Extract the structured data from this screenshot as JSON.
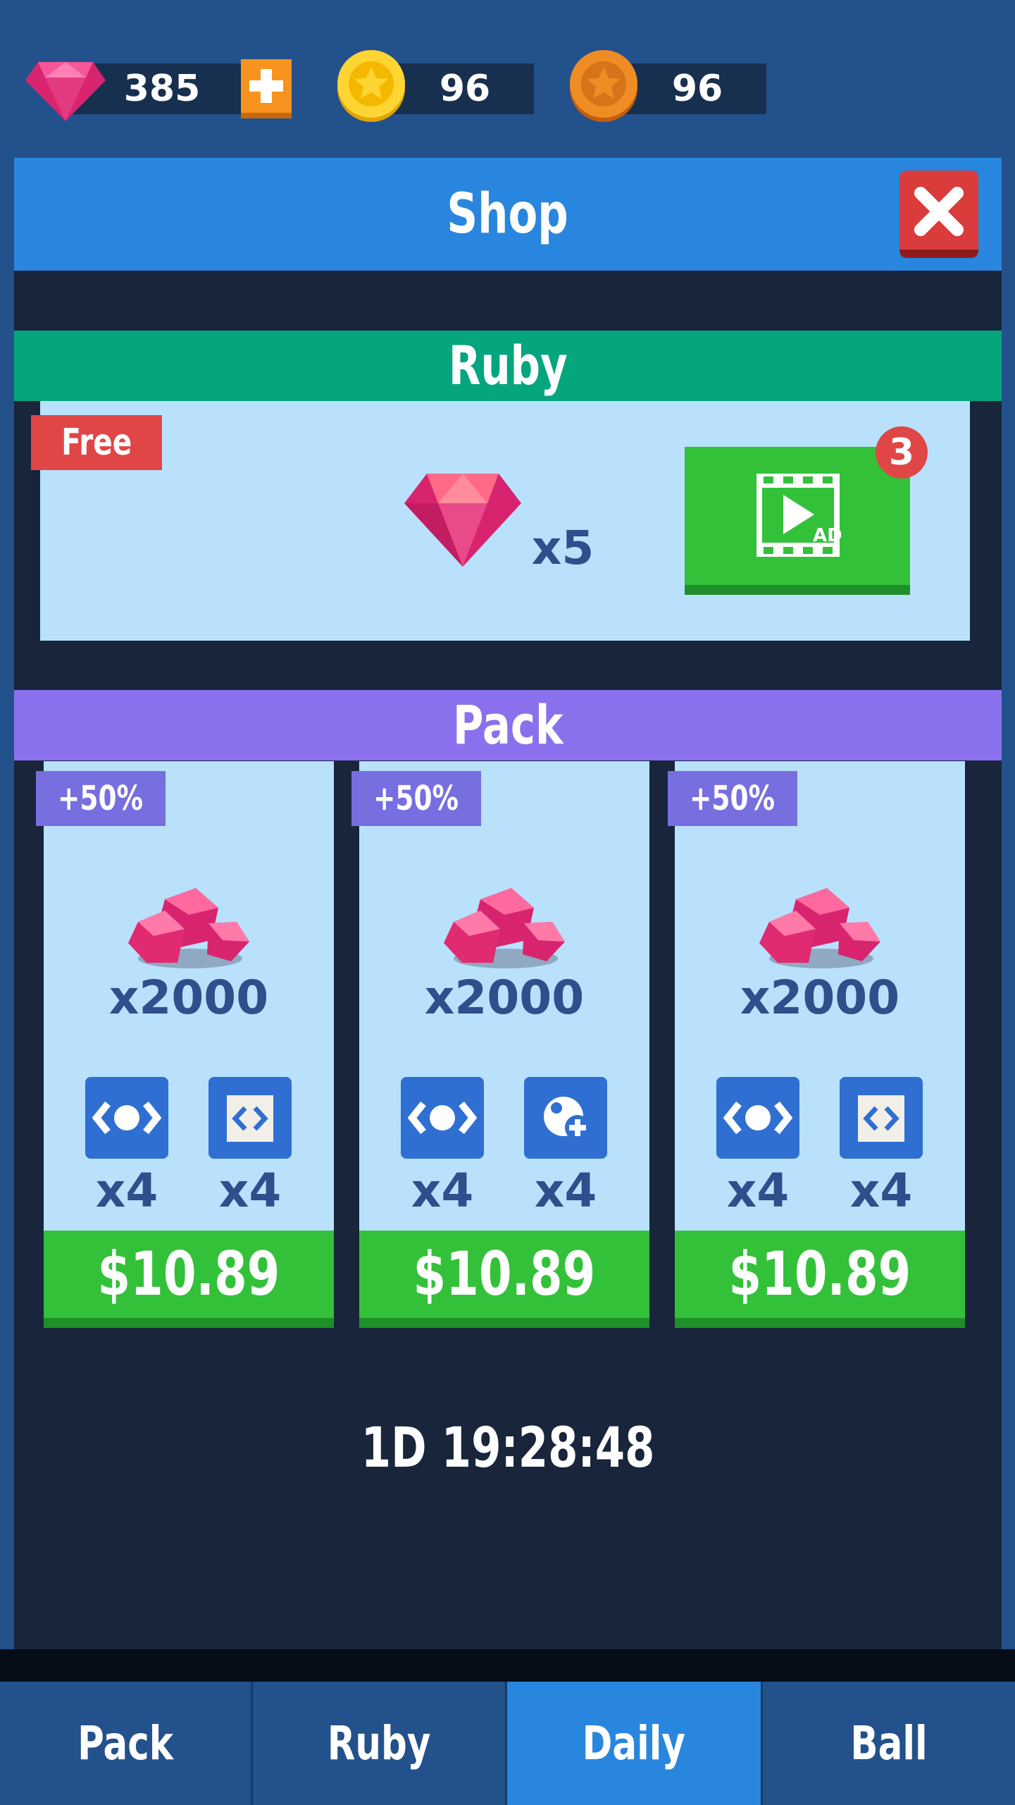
{
  "currency": {
    "ruby": "385",
    "gold_coins": "96",
    "bronze_coins": "96"
  },
  "shop": {
    "title": "Shop"
  },
  "ruby_section": {
    "title": "Ruby",
    "free_tag": "Free",
    "reward_amount": "x5",
    "ad_badge": "3"
  },
  "pack_section": {
    "title": "Pack",
    "packs": [
      {
        "bonus": "+50%",
        "ruby_amount": "x2000",
        "item1_count": "x4",
        "item2_count": "x4",
        "price": "$10.89",
        "item1_icon": "eye-icon",
        "item2_icon": "code-brackets-icon"
      },
      {
        "bonus": "+50%",
        "ruby_amount": "x2000",
        "item1_count": "x4",
        "item2_count": "x4",
        "price": "$10.89",
        "item1_icon": "eye-icon",
        "item2_icon": "ball-plus-icon"
      },
      {
        "bonus": "+50%",
        "ruby_amount": "x2000",
        "item1_count": "x4",
        "item2_count": "x4",
        "price": "$10.89",
        "item1_icon": "eye-icon",
        "item2_icon": "code-brackets-icon"
      }
    ]
  },
  "timer": "1D 19:28:48",
  "tabs": [
    {
      "label": "Pack",
      "active": false
    },
    {
      "label": "Ruby",
      "active": false
    },
    {
      "label": "Daily",
      "active": true
    },
    {
      "label": "Ball",
      "active": false
    }
  ],
  "colors": {
    "background": "#23518b",
    "panel": "#18253b",
    "shop_header": "#2886de",
    "ruby_header": "#05a57d",
    "pack_header": "#8b70ee",
    "card": "#b9e1fb",
    "price_green": "#33c13a",
    "bonus_tag": "#776ee0",
    "free_tag": "#e04646",
    "close_button": "#da3b3b"
  }
}
